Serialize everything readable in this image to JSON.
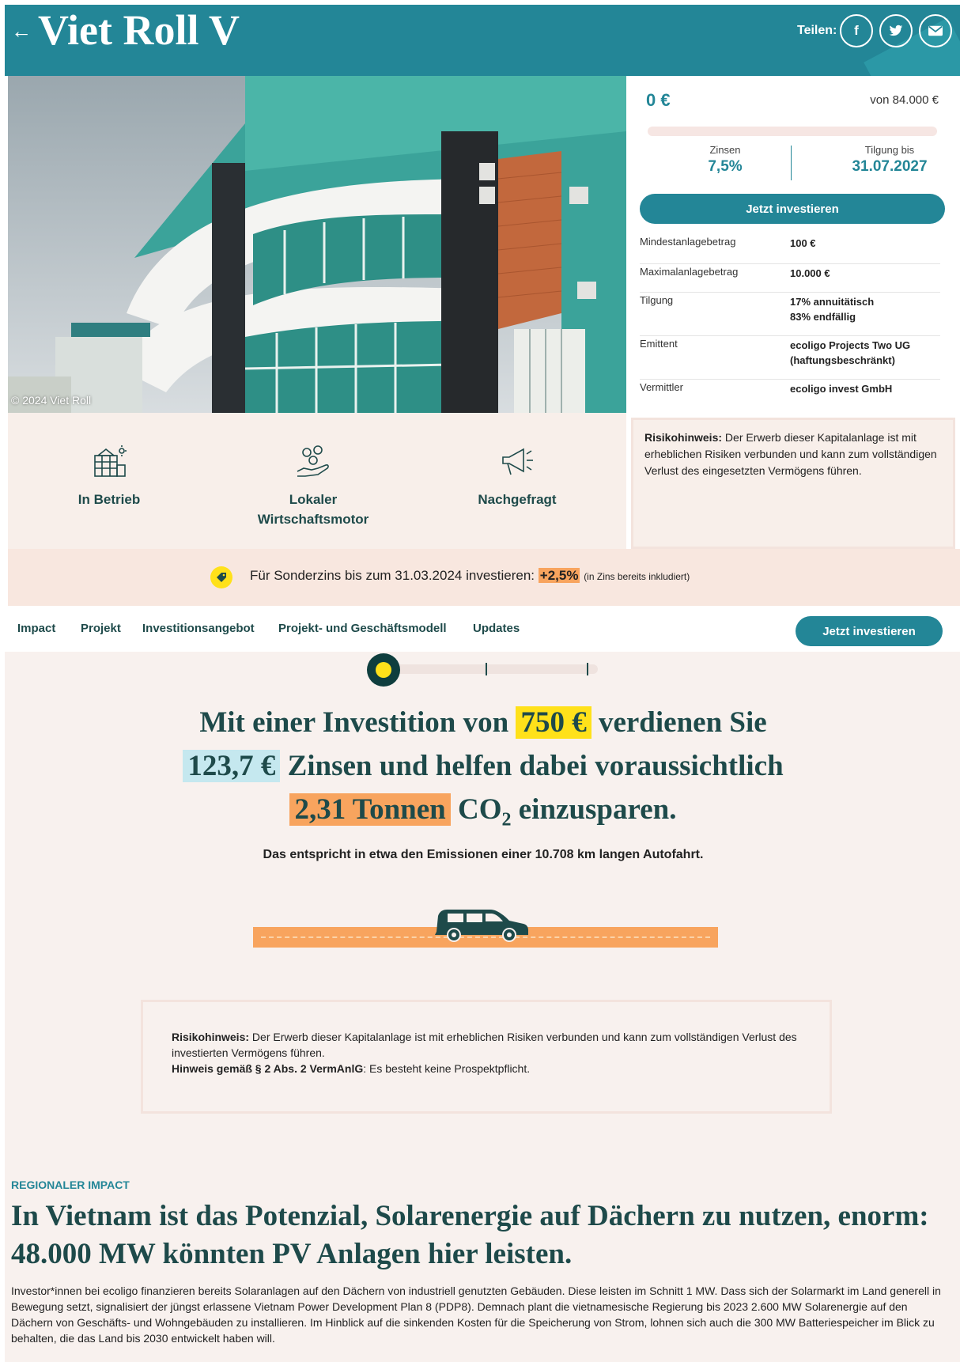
{
  "header": {
    "back_icon": "arrow-left-icon",
    "title": "Viet Roll V",
    "share_label": "Teilen:",
    "share_icons": [
      "facebook-icon",
      "twitter-icon",
      "mail-icon"
    ]
  },
  "hero": {
    "copyright": "© 2024 Viet Roll"
  },
  "investment": {
    "raised": "0 €",
    "goal": "von 84.000 €",
    "progress_fraction": 0,
    "interest_label": "Zinsen",
    "interest_value": "7,5%",
    "repayment_label": "Tilgung bis",
    "repayment_value": "31.07.2027",
    "invest_button": "Jetzt investieren",
    "details": [
      {
        "label": "Mindestanlagebetrag",
        "value": "100 €"
      },
      {
        "label": "Maximalanlagebetrag",
        "value": "10.000 €"
      },
      {
        "label": "Tilgung",
        "value": "17% annuitätisch\n83% endfällig"
      },
      {
        "label": "Emittent",
        "value": "ecoligo Projects Two UG\n(haftungsbeschränkt)"
      },
      {
        "label": "Vermittler",
        "value": "ecoligo invest GmbH"
      }
    ]
  },
  "features": [
    {
      "label": "In Betrieb",
      "icon": "solar-building-icon"
    },
    {
      "label": "Lokaler\nWirtschaftsmotor",
      "icon": "hand-coins-icon"
    },
    {
      "label": "Nachgefragt",
      "icon": "megaphone-icon"
    }
  ],
  "risk_box": {
    "title": "Risikohinweis:",
    "text": " Der Erwerb dieser Kapitalanlage ist mit erheblichen Risiken verbunden und kann zum vollständigen Verlust des eingesetzten Vermögens führen."
  },
  "promo": {
    "icon": "tag-icon",
    "text": "Für Sonderzins bis zum 31.03.2024 investieren:",
    "bonus": "+2,5%",
    "note": "(in Zins bereits inkludiert)"
  },
  "nav": {
    "items": [
      "Impact",
      "Projekt",
      "Investitionsangebot",
      "Projekt- und Geschäftsmodell",
      "Updates"
    ],
    "button": "Jetzt investieren"
  },
  "calculator": {
    "slider_fraction": 0,
    "text1": "Mit einer Investition von",
    "amount": "750 €",
    "text2": "verdienen Sie",
    "interest": "123,7 €",
    "text3": "Zinsen und helfen dabei voraussichtlich",
    "co2": "2,31 Tonnen",
    "text4": "CO",
    "text4_sub": "2",
    "text5": "einzusparen.",
    "equivalent": "Das entspricht in etwa den Emissionen einer 10.708 km langen Autofahrt."
  },
  "notice": {
    "risk_title": "Risikohinweis:",
    "risk_text": " Der Erwerb dieser Kapitalanlage ist mit erheblichen Risiken verbunden und kann zum vollständigen Verlust des investierten Vermögens führen.",
    "law_title": "Hinweis gemäß § 2 Abs. 2 VermAnlG",
    "law_text": ": Es besteht keine Prospektpflicht."
  },
  "regional": {
    "eyebrow": "REGIONALER IMPACT",
    "heading": "In Vietnam ist das Potenzial, Solarenergie auf Dächern zu nutzen, enorm: 48.000 MW könnten PV Anlagen hier leisten.",
    "paragraph": "Investor*innen bei ecoligo finanzieren bereits Solaranlagen auf den Dächern von industriell genutzten Gebäuden. Diese leisten im Schnitt 1 MW. Dass sich der Solarmarkt im Land generell in Bewegung setzt, signalisiert der jüngst erlassene Vietnam Power Development Plan 8 (PDP8). Demnach plant die vietnamesische Regierung bis 2023 2.600 MW Solarenergie auf den Dächern von Geschäfts- und Wohngebäuden zu installieren. Im Hinblick auf die sinkenden Kosten für die Speicherung von Strom, lohnen sich auch die 300 MW Batteriespeicher im Blick zu behalten, die das Land bis 2030 entwickelt haben will."
  },
  "colors": {
    "brand": "#238697",
    "dark": "#1e4a4a",
    "highlight_yellow": "#ffe11a",
    "highlight_orange": "#f8a45e",
    "highlight_blue": "#c5e8ef"
  }
}
